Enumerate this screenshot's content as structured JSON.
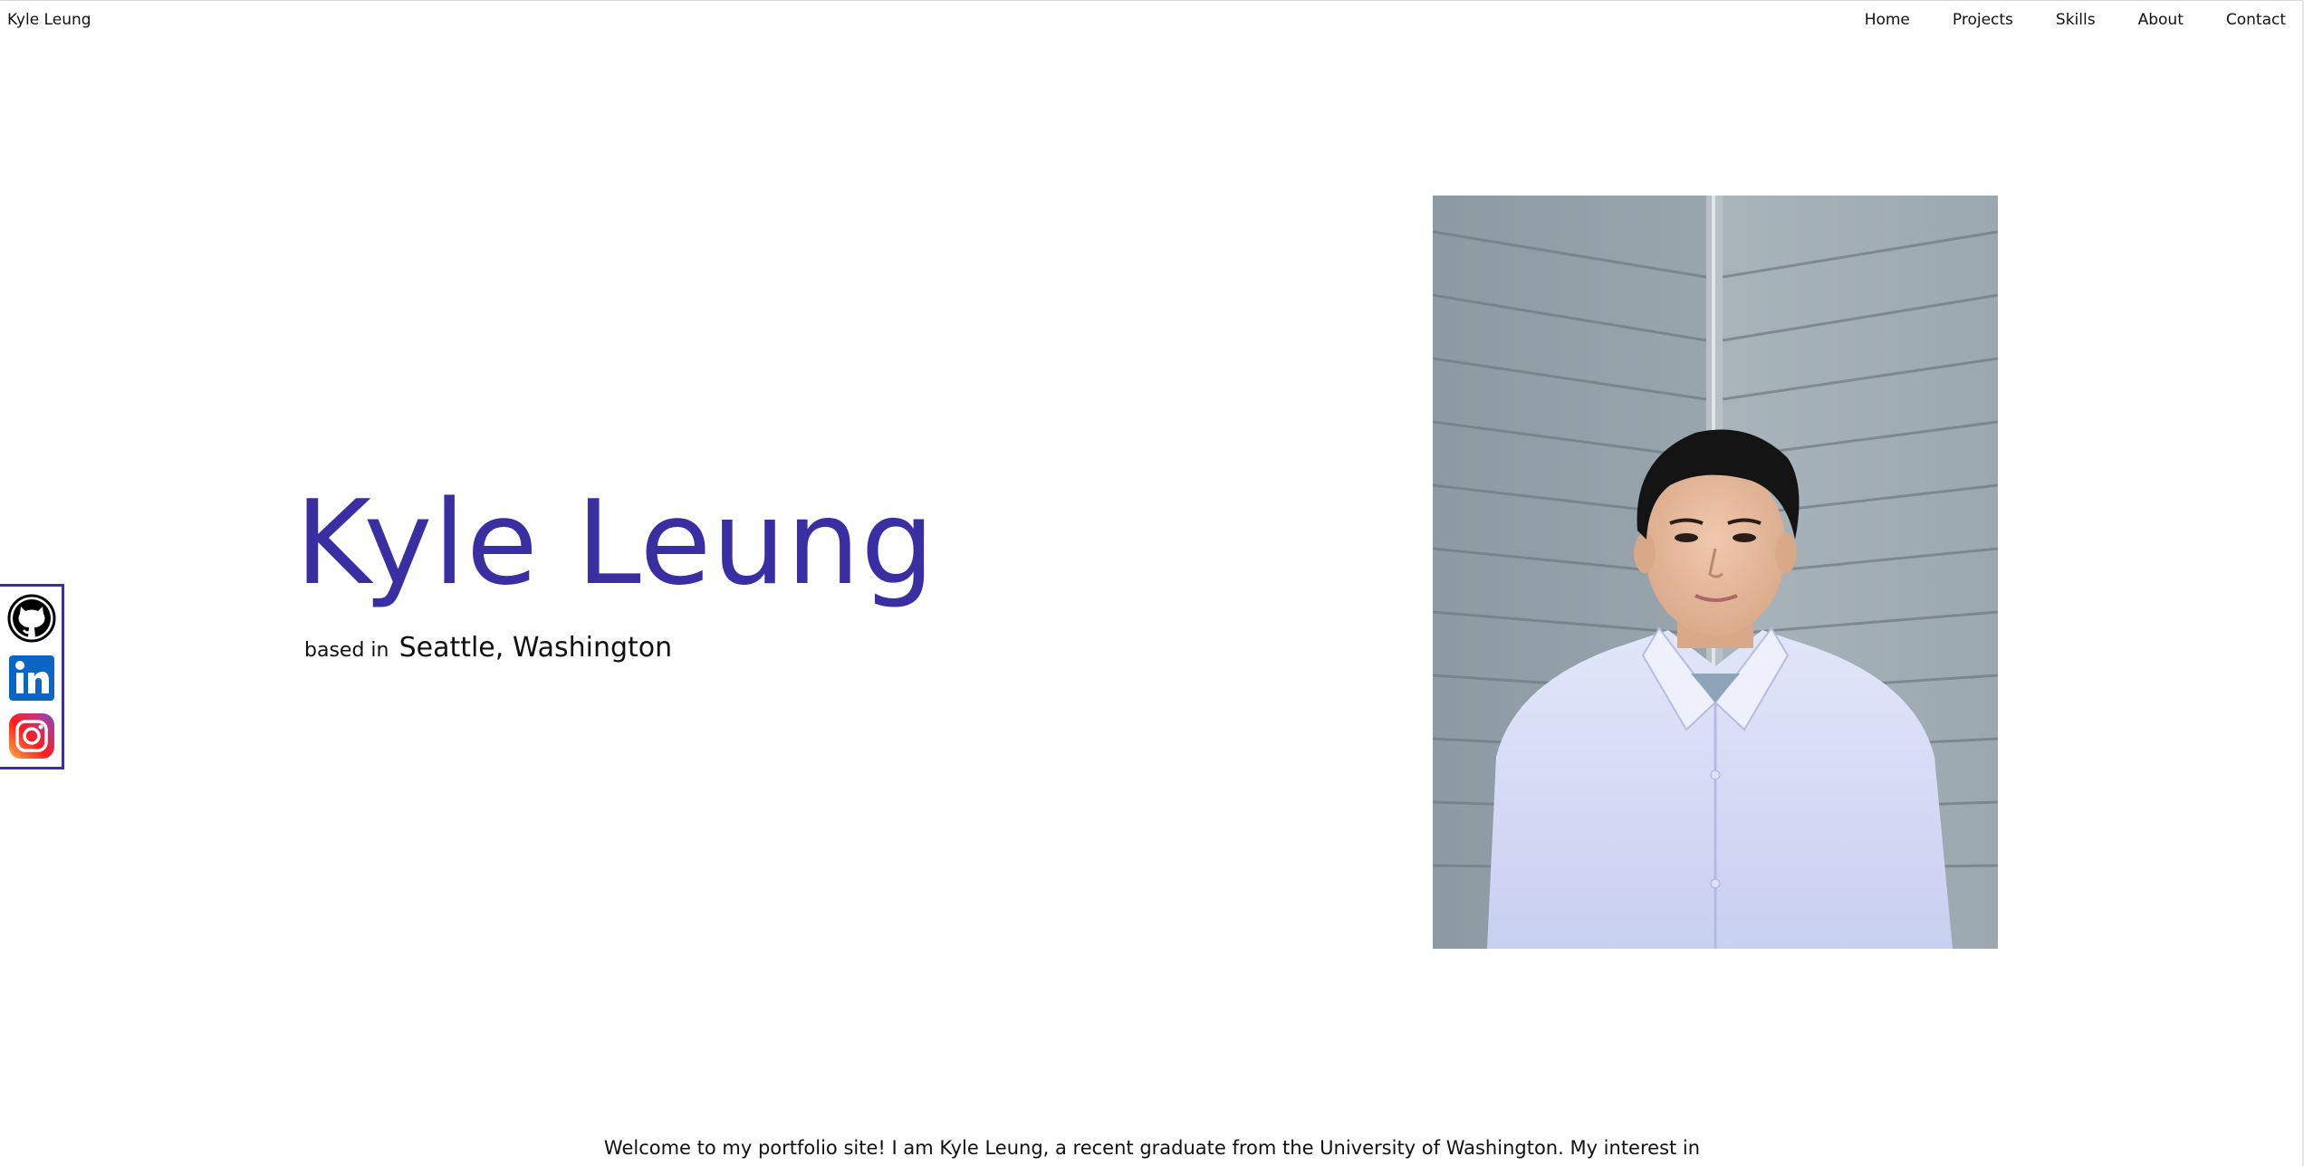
{
  "nav": {
    "brand": "Kyle Leung",
    "links": [
      "Home",
      "Projects",
      "Skills",
      "About",
      "Contact"
    ]
  },
  "hero": {
    "name": "Kyle Leung",
    "based_prefix": "based in",
    "location": "Seattle, Washington",
    "photo_icon": "portrait-photo"
  },
  "social": {
    "items": [
      "github-icon",
      "linkedin-icon",
      "instagram-icon"
    ]
  },
  "intro": {
    "text": "Welcome to my portfolio site! I am Kyle Leung, a recent graduate from the University of Washington. My interest in"
  },
  "colors": {
    "accent": "#3a2ea3",
    "linkedin": "#0a66c2"
  }
}
